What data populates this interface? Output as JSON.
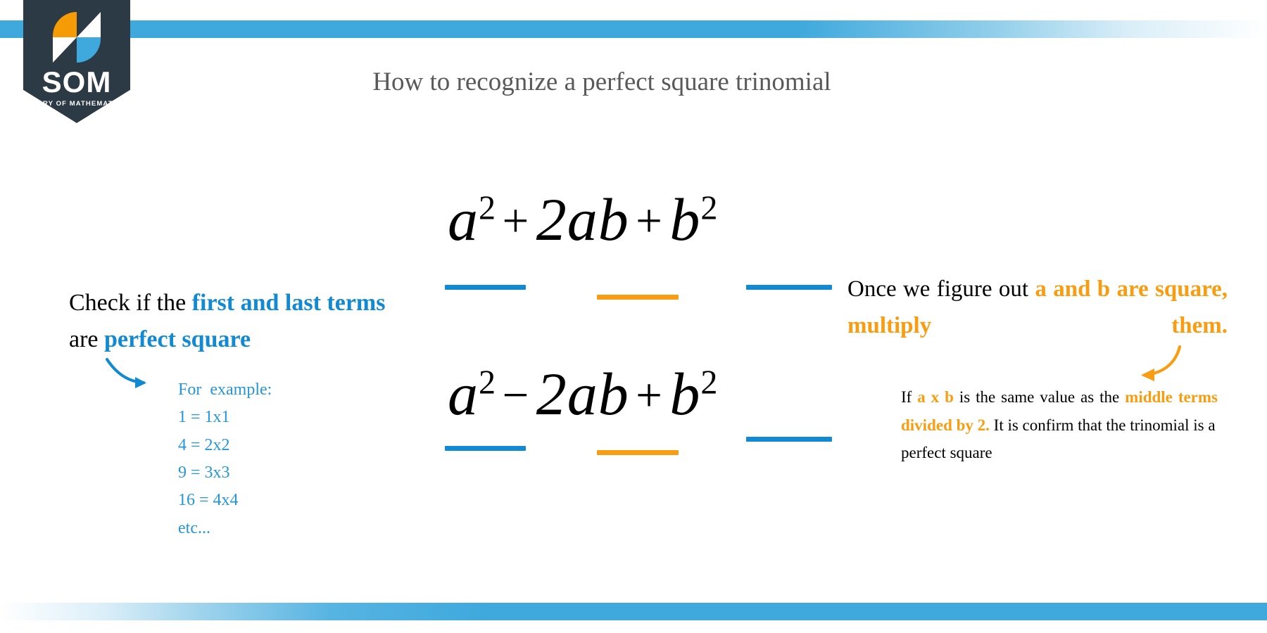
{
  "brand": {
    "logo_name": "SOM",
    "logo_tagline": "STORY OF MATHEMATICS",
    "icon": "som-s-logo-icon",
    "colors": {
      "shield": "#2b3a44",
      "orange": "#f59b05",
      "blue": "#3fa9dd",
      "white": "#ffffff"
    }
  },
  "title": "How to recognize a perfect square trinomial",
  "colors": {
    "accent_blue": "#1189d3",
    "accent_orange": "#f89c11",
    "light_blue": "#2596d8",
    "title_gray": "#595959",
    "bar_blue": "#3fa9dd"
  },
  "left": {
    "line1_plain": "Check if the ",
    "line1_emph": "first and last",
    "line2_emph_a": "terms",
    "line2_plain": " are ",
    "line2_emph_b": "perfect square",
    "arrow": "curved-arrow-down-right-icon",
    "examples_heading": "For  example:",
    "examples": [
      "1 = 1x1",
      "4 = 2x2",
      "9 = 3x3",
      "16 = 4x4",
      "etc..."
    ]
  },
  "formulas": [
    {
      "id": "perfect-square-sum",
      "terms": [
        "a",
        "2",
        "+",
        "2ab",
        "+",
        "b",
        "2"
      ],
      "plain": "a^2 + 2ab + b^2",
      "underlines": [
        {
          "term": "a^2",
          "color": "#1189d3"
        },
        {
          "term": "2ab",
          "color": "#f89c11"
        },
        {
          "term": "b^2",
          "color": "#1189d3"
        }
      ]
    },
    {
      "id": "perfect-square-difference",
      "terms": [
        "a",
        "2",
        "−",
        "2ab",
        "+",
        "b",
        "2"
      ],
      "plain": "a^2 − 2ab + b^2",
      "underlines": [
        {
          "term": "a^2",
          "color": "#1189d3"
        },
        {
          "term": "2ab",
          "color": "#f89c11"
        },
        {
          "term": "b^2",
          "color": "#1189d3"
        }
      ]
    }
  ],
  "math": {
    "a": "a",
    "b": "b",
    "sup2": "2",
    "plus": "+",
    "minus": "−",
    "two_ab": "2ab"
  },
  "right": {
    "headline_plain": "Once  we  figure  out  ",
    "headline_emph": "a  and  b",
    "headline_line2": "are  square, multiply them.",
    "arrow": "curved-arrow-down-left-icon",
    "para_1_plain": "If ",
    "para_1_emph": "a x b",
    "para_2_plain": " is  the  same  value  as  the  ",
    "para_2_emph": "middle  terms  divided  by  2.",
    "para_3_plain": " It  is  confirm  that  the  trinomial  is  a",
    "para_4_plain": "perfect square"
  }
}
